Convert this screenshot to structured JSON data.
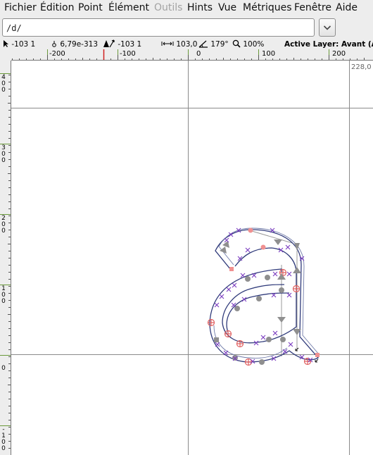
{
  "menu": {
    "items": [
      {
        "label": "Fichier"
      },
      {
        "label": "Édition"
      },
      {
        "label": "Point"
      },
      {
        "label": "Élément"
      },
      {
        "label": "Outils"
      },
      {
        "label": "Hints"
      },
      {
        "label": "Vue"
      },
      {
        "label": "Métriques"
      },
      {
        "label": "Fenêtre"
      },
      {
        "label": "Aide"
      }
    ]
  },
  "toolbar": {
    "glyph_field_value": "/d/"
  },
  "infobar": {
    "pointer_coords": "-103 1",
    "value_selected": "6,79e-313",
    "delta_coords": "-103 1",
    "distance": "103,0",
    "angle": "179°",
    "zoom": "100%",
    "active_layer": "Active Layer: Avant (A"
  },
  "ruler": {
    "h_labels": [
      "-200",
      "-100",
      "0",
      "100",
      "200"
    ],
    "v_labels": [
      "400",
      "300",
      "200",
      "100",
      "0",
      "-100"
    ]
  },
  "canvas": {
    "coord_readout": "228,0"
  },
  "colors": {
    "contour": "#2f3a7a",
    "grid": "#8a8a8a",
    "extremum": "#e06060",
    "hint": "#7a3bc0"
  }
}
